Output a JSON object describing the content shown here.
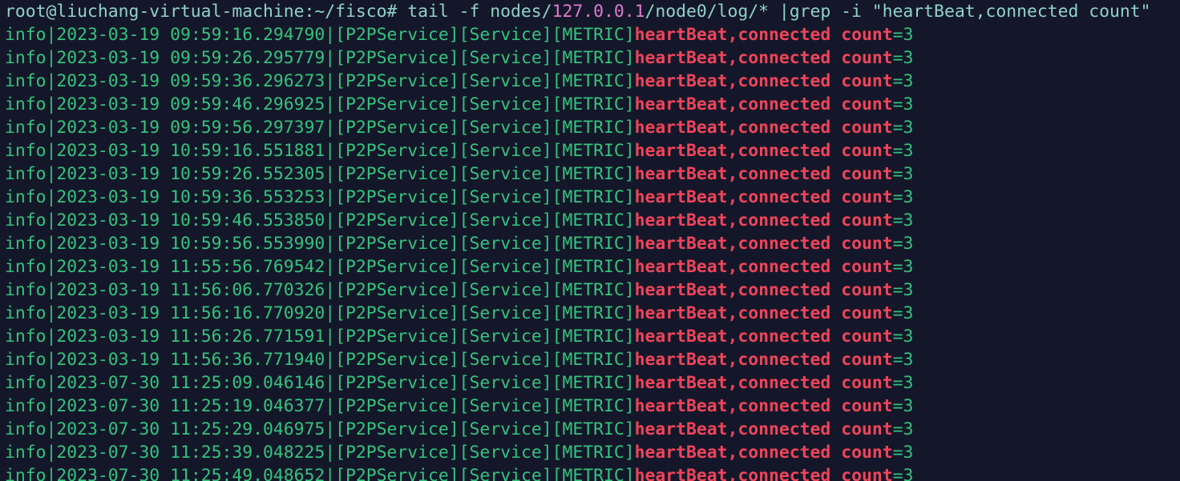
{
  "terminal": {
    "command": {
      "prompt": "root@liuchang-virtual-machine:~/fisco#",
      "cmd_before": " tail -f nodes/",
      "ip": "127.0.0.1",
      "cmd_after": "/node0/log/* |grep -i \"heartBeat,connected count\""
    },
    "log_level": "info",
    "log_tags": "[P2PService][Service][METRIC]",
    "match_a": "heartBeat,connected",
    "space": " ",
    "match_b": "count",
    "suffix": "=3",
    "lines": [
      {
        "timestamp": "2023-03-19 09:59:16.294790"
      },
      {
        "timestamp": "2023-03-19 09:59:26.295779"
      },
      {
        "timestamp": "2023-03-19 09:59:36.296273"
      },
      {
        "timestamp": "2023-03-19 09:59:46.296925"
      },
      {
        "timestamp": "2023-03-19 09:59:56.297397"
      },
      {
        "timestamp": "2023-03-19 10:59:16.551881"
      },
      {
        "timestamp": "2023-03-19 10:59:26.552305"
      },
      {
        "timestamp": "2023-03-19 10:59:36.553253"
      },
      {
        "timestamp": "2023-03-19 10:59:46.553850"
      },
      {
        "timestamp": "2023-03-19 10:59:56.553990"
      },
      {
        "timestamp": "2023-03-19 11:55:56.769542"
      },
      {
        "timestamp": "2023-03-19 11:56:06.770326"
      },
      {
        "timestamp": "2023-03-19 11:56:16.770920"
      },
      {
        "timestamp": "2023-03-19 11:56:26.771591"
      },
      {
        "timestamp": "2023-03-19 11:56:36.771940"
      },
      {
        "timestamp": "2023-07-30 11:25:09.046146"
      },
      {
        "timestamp": "2023-07-30 11:25:19.046377"
      },
      {
        "timestamp": "2023-07-30 11:25:29.046975"
      },
      {
        "timestamp": "2023-07-30 11:25:39.048225"
      },
      {
        "timestamp": "2023-07-30 11:25:49.048652"
      }
    ],
    "colors": {
      "background": "#141729",
      "prompt": "#8fd3c8",
      "ip": "#e07ad0",
      "log_text": "#34c37e",
      "match_highlight": "#f0445a"
    }
  }
}
